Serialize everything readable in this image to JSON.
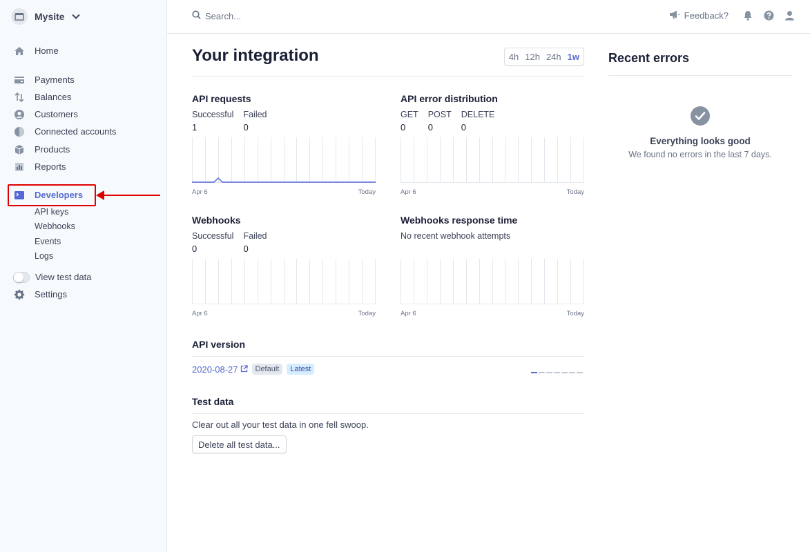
{
  "account": {
    "name": "Mysite"
  },
  "nav": {
    "home": "Home",
    "payments": "Payments",
    "balances": "Balances",
    "customers": "Customers",
    "connected_accounts": "Connected accounts",
    "products": "Products",
    "reports": "Reports",
    "developers": "Developers",
    "developers_sub": [
      "API keys",
      "Webhooks",
      "Events",
      "Logs"
    ],
    "view_test_data": "View test data",
    "settings": "Settings"
  },
  "topbar": {
    "search_placeholder": "Search...",
    "feedback": "Feedback?"
  },
  "main": {
    "title": "Your integration",
    "ranges": [
      "4h",
      "12h",
      "24h",
      "1w"
    ],
    "active_range": "1w",
    "api_requests": {
      "title": "API requests",
      "stats": [
        {
          "label": "Successful",
          "value": "1"
        },
        {
          "label": "Failed",
          "value": "0"
        }
      ],
      "axis_start": "Apr 6",
      "axis_end": "Today"
    },
    "api_errors": {
      "title": "API error distribution",
      "stats": [
        {
          "label": "GET",
          "value": "0"
        },
        {
          "label": "POST",
          "value": "0"
        },
        {
          "label": "DELETE",
          "value": "0"
        }
      ],
      "axis_start": "Apr 6",
      "axis_end": "Today"
    },
    "webhooks": {
      "title": "Webhooks",
      "stats": [
        {
          "label": "Successful",
          "value": "0"
        },
        {
          "label": "Failed",
          "value": "0"
        }
      ],
      "axis_start": "Apr 6",
      "axis_end": "Today"
    },
    "webhooks_response": {
      "title": "Webhooks response time",
      "note": "No recent webhook attempts",
      "axis_start": "Apr 6",
      "axis_end": "Today"
    },
    "api_version": {
      "title": "API version",
      "version": "2020-08-27",
      "badge_default": "Default",
      "badge_latest": "Latest"
    },
    "test_data": {
      "title": "Test data",
      "description": "Clear out all your test data in one fell swoop.",
      "button": "Delete all test data..."
    }
  },
  "right": {
    "title": "Recent errors",
    "status_title": "Everything looks good",
    "status_sub": "We found no errors in the last 7 days."
  },
  "colors": {
    "accent": "#5469d4",
    "annotation": "#e00000"
  }
}
